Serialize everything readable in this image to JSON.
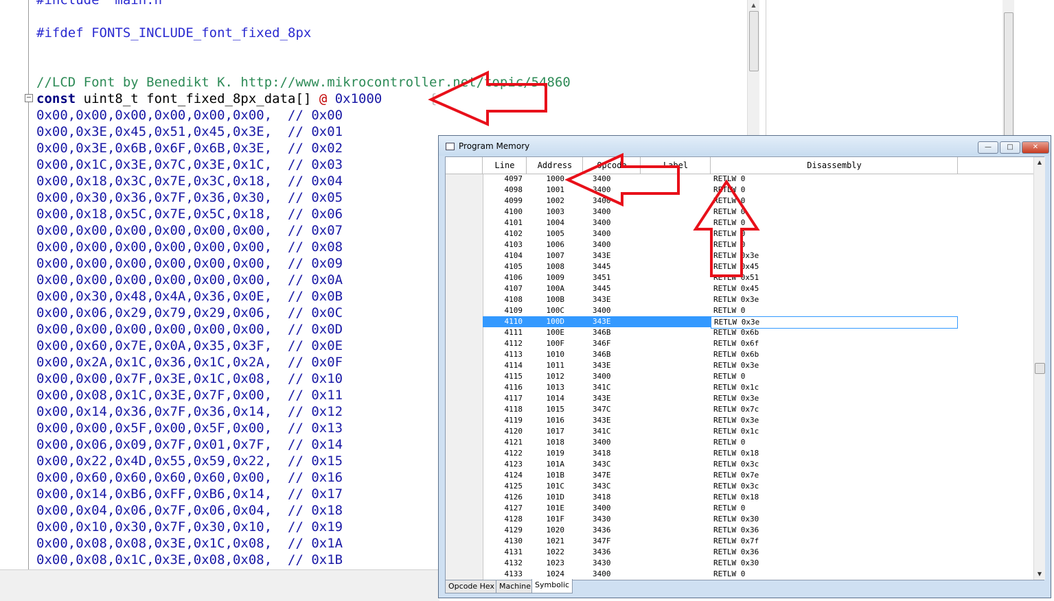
{
  "editor": {
    "lines": [
      {
        "text": "#include  main.h",
        "cls": "pp"
      },
      {
        "text": "#ifdef FONTS_INCLUDE_font_fixed_8px",
        "cls": "pp"
      },
      {
        "text": "",
        "cls": "plain"
      },
      {
        "text": "",
        "cls": "plain"
      },
      {
        "text": "//LCD Font by Benedikt K. http://www.mikrocontroller.net/topic/54860",
        "cls": "cm"
      },
      {
        "text": "",
        "cls": "decl"
      },
      {
        "text": "0x00,0x00,0x00,0x00,0x00,0x00,  // 0x00",
        "cls": "num"
      },
      {
        "text": "0x00,0x3E,0x45,0x51,0x45,0x3E,  // 0x01",
        "cls": "num"
      },
      {
        "text": "0x00,0x3E,0x6B,0x6F,0x6B,0x3E,  // 0x02",
        "cls": "num"
      },
      {
        "text": "0x00,0x1C,0x3E,0x7C,0x3E,0x1C,  // 0x03",
        "cls": "num"
      },
      {
        "text": "0x00,0x18,0x3C,0x7E,0x3C,0x18,  // 0x04",
        "cls": "num"
      },
      {
        "text": "0x00,0x30,0x36,0x7F,0x36,0x30,  // 0x05",
        "cls": "num"
      },
      {
        "text": "0x00,0x18,0x5C,0x7E,0x5C,0x18,  // 0x06",
        "cls": "num"
      },
      {
        "text": "0x00,0x00,0x00,0x00,0x00,0x00,  // 0x07",
        "cls": "num"
      },
      {
        "text": "0x00,0x00,0x00,0x00,0x00,0x00,  // 0x08",
        "cls": "num"
      },
      {
        "text": "0x00,0x00,0x00,0x00,0x00,0x00,  // 0x09",
        "cls": "num"
      },
      {
        "text": "0x00,0x00,0x00,0x00,0x00,0x00,  // 0x0A",
        "cls": "num"
      },
      {
        "text": "0x00,0x30,0x48,0x4A,0x36,0x0E,  // 0x0B",
        "cls": "num"
      },
      {
        "text": "0x00,0x06,0x29,0x79,0x29,0x06,  // 0x0C",
        "cls": "num"
      },
      {
        "text": "0x00,0x00,0x00,0x00,0x00,0x00,  // 0x0D",
        "cls": "num"
      },
      {
        "text": "0x00,0x60,0x7E,0x0A,0x35,0x3F,  // 0x0E",
        "cls": "num"
      },
      {
        "text": "0x00,0x2A,0x1C,0x36,0x1C,0x2A,  // 0x0F",
        "cls": "num"
      },
      {
        "text": "0x00,0x00,0x7F,0x3E,0x1C,0x08,  // 0x10",
        "cls": "num"
      },
      {
        "text": "0x00,0x08,0x1C,0x3E,0x7F,0x00,  // 0x11",
        "cls": "num"
      },
      {
        "text": "0x00,0x14,0x36,0x7F,0x36,0x14,  // 0x12",
        "cls": "num"
      },
      {
        "text": "0x00,0x00,0x5F,0x00,0x5F,0x00,  // 0x13",
        "cls": "num"
      },
      {
        "text": "0x00,0x06,0x09,0x7F,0x01,0x7F,  // 0x14",
        "cls": "num"
      },
      {
        "text": "0x00,0x22,0x4D,0x55,0x59,0x22,  // 0x15",
        "cls": "num"
      },
      {
        "text": "0x00,0x60,0x60,0x60,0x60,0x00,  // 0x16",
        "cls": "num"
      },
      {
        "text": "0x00,0x14,0xB6,0xFF,0xB6,0x14,  // 0x17",
        "cls": "num"
      },
      {
        "text": "0x00,0x04,0x06,0x7F,0x06,0x04,  // 0x18",
        "cls": "num"
      },
      {
        "text": "0x00,0x10,0x30,0x7F,0x30,0x10,  // 0x19",
        "cls": "num"
      },
      {
        "text": "0x00,0x08,0x08,0x3E,0x1C,0x08,  // 0x1A",
        "cls": "num"
      },
      {
        "text": "0x00,0x08,0x1C,0x3E,0x08,0x08,  // 0x1B",
        "cls": "num"
      }
    ],
    "decl": {
      "keyword": "const",
      "type_and_name": " uint8_t font_fixed_8px_data",
      "brackets": "[] ",
      "at": "@",
      "address": " 0x1000",
      "brace": "      {"
    },
    "fold_symbol": "−"
  },
  "program_memory": {
    "title": "Program Memory",
    "window_buttons": {
      "minimize": "—",
      "maximize": "□",
      "close": "✕"
    },
    "columns": {
      "line": "Line",
      "address": "Address",
      "opcode": "Opcode",
      "label": "Label",
      "disassembly": "Disassembly"
    },
    "selected_index": 13,
    "rows": [
      [
        "4097",
        "1000",
        "3400",
        "RETLW 0"
      ],
      [
        "4098",
        "1001",
        "3400",
        "RETLW 0"
      ],
      [
        "4099",
        "1002",
        "3400",
        "RETLW 0"
      ],
      [
        "4100",
        "1003",
        "3400",
        "RETLW 0"
      ],
      [
        "4101",
        "1004",
        "3400",
        "RETLW 0"
      ],
      [
        "4102",
        "1005",
        "3400",
        "RETLW 0"
      ],
      [
        "4103",
        "1006",
        "3400",
        "RETLW 0"
      ],
      [
        "4104",
        "1007",
        "343E",
        "RETLW 0x3e"
      ],
      [
        "4105",
        "1008",
        "3445",
        "RETLW 0x45"
      ],
      [
        "4106",
        "1009",
        "3451",
        "RETLW 0x51"
      ],
      [
        "4107",
        "100A",
        "3445",
        "RETLW 0x45"
      ],
      [
        "4108",
        "100B",
        "343E",
        "RETLW 0x3e"
      ],
      [
        "4109",
        "100C",
        "3400",
        "RETLW 0"
      ],
      [
        "4110",
        "100D",
        "343E",
        "RETLW 0x3e"
      ],
      [
        "4111",
        "100E",
        "346B",
        "RETLW 0x6b"
      ],
      [
        "4112",
        "100F",
        "346F",
        "RETLW 0x6f"
      ],
      [
        "4113",
        "1010",
        "346B",
        "RETLW 0x6b"
      ],
      [
        "4114",
        "1011",
        "343E",
        "RETLW 0x3e"
      ],
      [
        "4115",
        "1012",
        "3400",
        "RETLW 0"
      ],
      [
        "4116",
        "1013",
        "341C",
        "RETLW 0x1c"
      ],
      [
        "4117",
        "1014",
        "343E",
        "RETLW 0x3e"
      ],
      [
        "4118",
        "1015",
        "347C",
        "RETLW 0x7c"
      ],
      [
        "4119",
        "1016",
        "343E",
        "RETLW 0x3e"
      ],
      [
        "4120",
        "1017",
        "341C",
        "RETLW 0x1c"
      ],
      [
        "4121",
        "1018",
        "3400",
        "RETLW 0"
      ],
      [
        "4122",
        "1019",
        "3418",
        "RETLW 0x18"
      ],
      [
        "4123",
        "101A",
        "343C",
        "RETLW 0x3c"
      ],
      [
        "4124",
        "101B",
        "347E",
        "RETLW 0x7e"
      ],
      [
        "4125",
        "101C",
        "343C",
        "RETLW 0x3c"
      ],
      [
        "4126",
        "101D",
        "3418",
        "RETLW 0x18"
      ],
      [
        "4127",
        "101E",
        "3400",
        "RETLW 0"
      ],
      [
        "4128",
        "101F",
        "3430",
        "RETLW 0x30"
      ],
      [
        "4129",
        "1020",
        "3436",
        "RETLW 0x36"
      ],
      [
        "4130",
        "1021",
        "347F",
        "RETLW 0x7f"
      ],
      [
        "4131",
        "1022",
        "3436",
        "RETLW 0x36"
      ],
      [
        "4132",
        "1023",
        "3430",
        "RETLW 0x30"
      ],
      [
        "4133",
        "1024",
        "3400",
        "RETLW 0"
      ]
    ],
    "tabs": [
      "Opcode Hex",
      "Machine",
      "Symbolic"
    ],
    "active_tab": "Symbolic",
    "selection_color": "#3399ff"
  },
  "annotations": {
    "arrow_color": "#e8101a"
  }
}
